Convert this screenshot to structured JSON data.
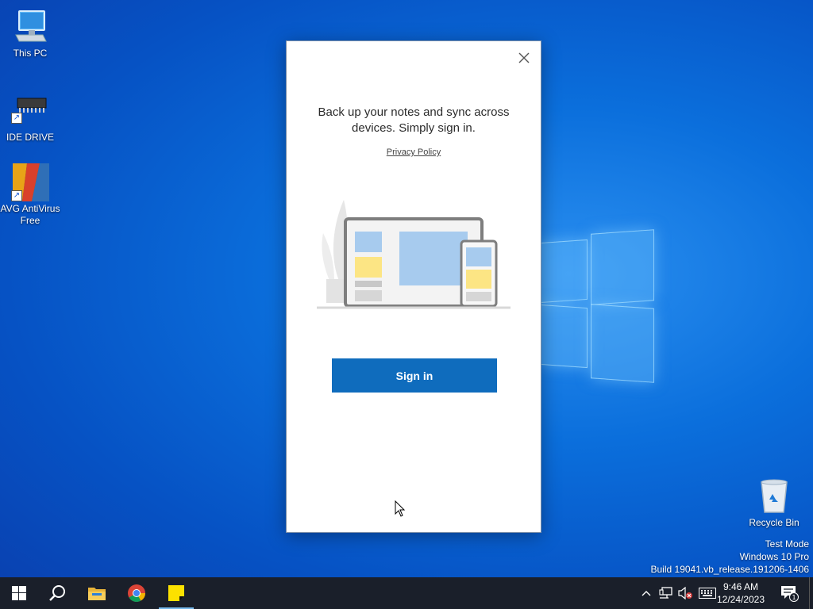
{
  "desktop": {
    "icons": [
      {
        "label": "This PC"
      },
      {
        "label": "IDE DRIVE"
      },
      {
        "label": "AVG AntiVirus Free"
      },
      {
        "label": "Recycle Bin"
      }
    ],
    "watermark": {
      "line1": "Test Mode",
      "line2": "Windows 10 Pro",
      "line3": "Build 19041.vb_release.191206-1406"
    }
  },
  "dialog": {
    "title": "Back up your notes and sync across devices. Simply sign in.",
    "privacy_link": "Privacy Policy",
    "signin_label": "Sign in",
    "close_icon": "close-icon"
  },
  "taskbar": {
    "apps": [
      "start-icon",
      "search-icon",
      "file-explorer-icon",
      "chrome-icon",
      "sticky-notes-icon"
    ],
    "clock_time": "9:46 AM",
    "clock_date": "12/24/2023",
    "notification_count": "1"
  },
  "colors": {
    "accent": "#0f6cbd",
    "taskbar": "#1a1f2a",
    "sticky_yellow": "#fce100"
  }
}
